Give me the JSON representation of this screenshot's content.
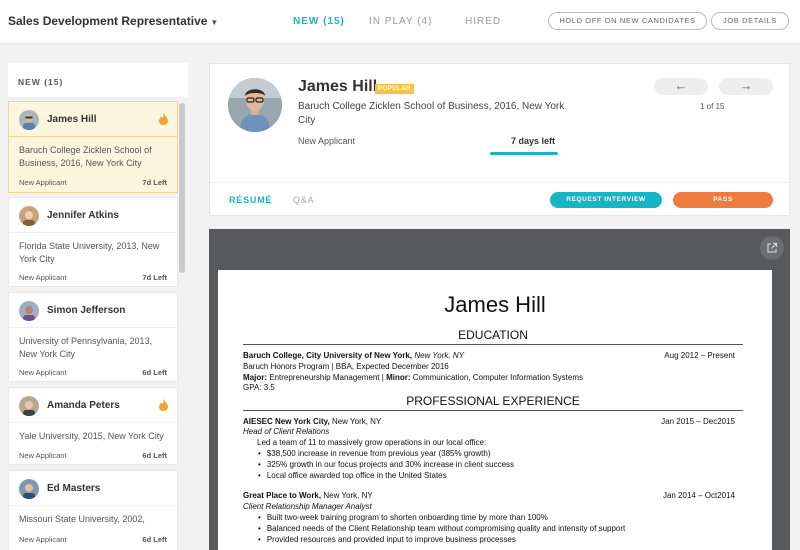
{
  "header": {
    "job_title": "Sales Development Representative",
    "tabs": [
      {
        "label": "NEW (15)",
        "active": true
      },
      {
        "label": "IN PLAY (4)",
        "active": false
      },
      {
        "label": "HIRED",
        "active": false
      }
    ],
    "hold_button": "HOLD OFF ON NEW CANDIDATES",
    "details_button": "JOB DETAILS"
  },
  "list": {
    "header": "NEW (15)",
    "candidates": [
      {
        "name": "James Hill",
        "school": "Baruch College Zicklen School of Business, 2016, New York City",
        "status": "New Applicant",
        "days": "7d Left",
        "popular": true,
        "selected": true
      },
      {
        "name": "Jennifer Atkins",
        "school": "Florida State University, 2013, New York City",
        "status": "New Applicant",
        "days": "7d Left",
        "popular": false
      },
      {
        "name": "Simon Jefferson",
        "school": "University of Pennsylvania, 2013, New York City",
        "status": "New Applicant",
        "days": "6d Left",
        "popular": false
      },
      {
        "name": "Amanda Peters",
        "school": "Yale University, 2015, New York City",
        "status": "New Applicant",
        "days": "6d Left",
        "popular": true
      },
      {
        "name": "Ed Masters",
        "school": "Missouri State University, 2002,",
        "status": "New Applicant",
        "days": "6d Left",
        "popular": false
      }
    ]
  },
  "profile": {
    "name": "James Hill",
    "badge": "POPULAR",
    "school": "Baruch College Zicklen School of Business, 2016, New York City",
    "status": "New Applicant",
    "days_left": "7 days left",
    "prev_arrow": "←",
    "next_arrow": "→",
    "count": "1 of 15",
    "tabs": [
      {
        "label": "RÉSUMÉ",
        "active": true
      },
      {
        "label": "Q&A",
        "active": false
      }
    ],
    "request_button": "REQUEST INTERVIEW",
    "pass_button": "PASS"
  },
  "resume": {
    "name": "James Hill",
    "education_heading": "EDUCATION",
    "edu_school": "Baruch College, City University of New York,",
    "edu_location": "New York, NY",
    "edu_dates": "Aug 2012 – Present",
    "edu_program": "Baruch Honors Program | BBA, Expected December 2016",
    "edu_major_label": "Major:",
    "edu_major": "Entrepreneurship Management |",
    "edu_minor_label": "Minor:",
    "edu_minor": "Communication, Computer Information Systems",
    "edu_gpa": "GPA: 3.5",
    "experience_heading": "PROFESSIONAL EXPERIENCE",
    "job1_company": "AIESEC New York City,",
    "job1_location": "New York, NY",
    "job1_dates": "Jan 2015 – Dec2015",
    "job1_title": "Head of Client Relations",
    "job1_summary": "Led a team of 11 to massively grow operations in our local office:",
    "job1_bullets": [
      "$38,500 increase in revenue from previous year (385% growth)",
      "325% growth in our focus projects and 30% increase in client success",
      "Local office awarded top office in the United States"
    ],
    "job2_company": "Great Place to Work,",
    "job2_location": "New York, NY",
    "job2_dates": "Jan 2014 – Oct2014",
    "job2_title": "Client Relationship Manager Analyst",
    "job2_bullets": [
      "Built two-week training program to shorten onboarding time by more than 100%",
      "Balanced needs of the Client Relationship team without compromising quality and intensity of support",
      "Provided resources and provided input to improve business processes"
    ]
  },
  "colors": {
    "accent": "#18b5c4",
    "pass": "#f07b3f",
    "popular": "#f4c542",
    "flame": "#f2a531",
    "selected_bg": "#fdf6de"
  },
  "icons": [
    "caret-down-icon",
    "flame-icon",
    "arrow-left-icon",
    "arrow-right-icon",
    "external-link-icon",
    "avatar"
  ]
}
